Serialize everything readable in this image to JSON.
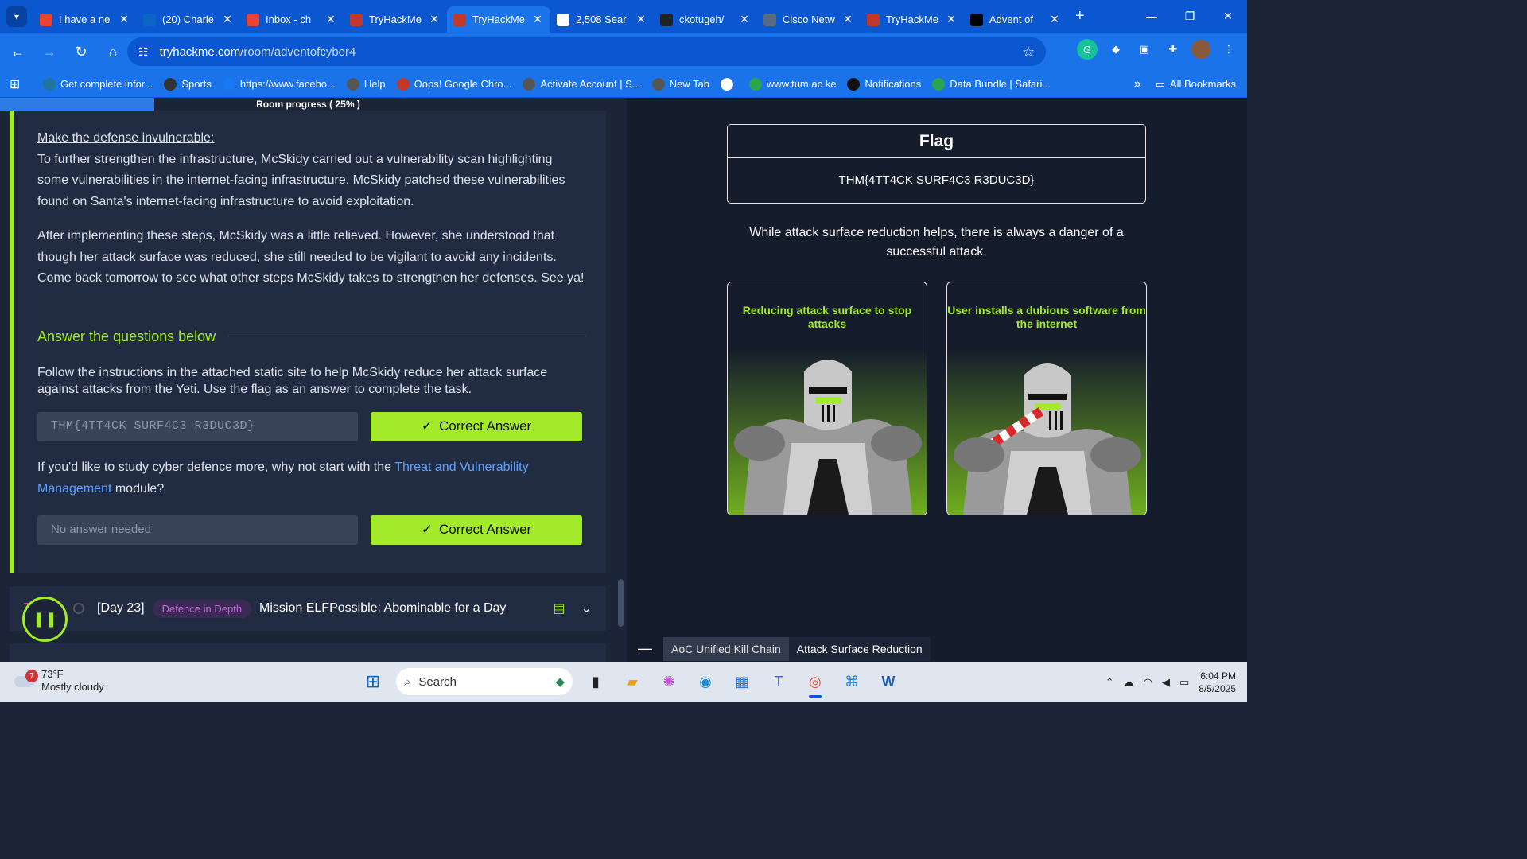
{
  "browser": {
    "tabs": [
      {
        "title": "I have a ne",
        "favicon": "gmail",
        "color": "#ea4335"
      },
      {
        "title": "(20) Charle",
        "favicon": "linkedin",
        "color": "#0a66c2"
      },
      {
        "title": "Inbox - ch",
        "favicon": "gmail",
        "color": "#ea4335"
      },
      {
        "title": "TryHackMe",
        "favicon": "tryhackme",
        "color": "#c0392b"
      },
      {
        "title": "TryHackMe",
        "favicon": "tryhackme",
        "color": "#c0392b",
        "active": true
      },
      {
        "title": "2,508 Sear",
        "favicon": "github",
        "color": "#ffffff"
      },
      {
        "title": "ckotugeh/",
        "favicon": "github",
        "color": "#222222"
      },
      {
        "title": "Cisco Netw",
        "favicon": "cisco",
        "color": "#5b6b7f"
      },
      {
        "title": "TryHackMe",
        "favicon": "tryhackme",
        "color": "#c0392b"
      },
      {
        "title": "Advent of",
        "favicon": "medium",
        "color": "#000000"
      }
    ],
    "url_domain": "tryhackme.com",
    "url_path": "/room/adventofcyber4",
    "bookmarks": [
      {
        "label": "Get complete infor...",
        "icon": "wordpress"
      },
      {
        "label": "Sports",
        "icon": "sp"
      },
      {
        "label": "https://www.facebo...",
        "icon": "facebook"
      },
      {
        "label": "Help",
        "icon": "globe"
      },
      {
        "label": "Oops! Google Chro...",
        "icon": "tryhackme"
      },
      {
        "label": "Activate Account | S...",
        "icon": "globe"
      },
      {
        "label": "New Tab",
        "icon": "globe"
      },
      {
        "label": "",
        "icon": "google"
      },
      {
        "label": "www.tum.ac.ke",
        "icon": "s"
      },
      {
        "label": "Notifications",
        "icon": "upwork"
      },
      {
        "label": "Data Bundle | Safari...",
        "icon": "s"
      }
    ],
    "all_bookmarks": "All Bookmarks"
  },
  "room": {
    "progress_label": "Room progress ( 25% )",
    "progress_value": 0.25,
    "heading": "Make the defense invulnerable:",
    "para1": "To further strengthen the infrastructure, McSkidy carried out a vulnerability scan highlighting some vulnerabilities in the internet-facing infrastructure. McSkidy patched these vulnerabilities found on Santa's internet-facing infrastructure to avoid exploitation.",
    "para2": "After implementing these steps, McSkidy was a little relieved. However, she understood that though her attack surface was reduced, she still needed to be vigilant to avoid any incidents. Come back tomorrow to see what other steps McSkidy takes to strengthen her defenses. See ya!",
    "answer_heading": "Answer the questions below",
    "q1": "Follow the instructions in the attached static site to help McSkidy reduce her attack surface against attacks from the Yeti. Use the flag as an answer to complete the task.",
    "q1_answer": "THM{4TT4CK SURF4C3 R3DUC3D}",
    "correct_label": "Correct Answer",
    "q2_prefix": "If you'd like to study cyber defence more, why not start with the ",
    "q2_link": "Threat and Vulnerability Management",
    "q2_suffix": " module?",
    "q2_answer": "No answer needed",
    "next_day": "[Day 23]",
    "next_tag": "Defence in Depth",
    "next_title": "Mission ELFPossible: Abominable for a Day",
    "next_task_prefix": "T"
  },
  "site": {
    "flag_title": "Flag",
    "flag_value": "THM{4TT4CK SURF4C3 R3DUC3D}",
    "note": "While attack surface reduction helps, there is always a danger of a successful attack.",
    "card1_caption": "Reducing attack surface to stop attacks",
    "card2_caption": "User installs a dubious software from the internet",
    "tab_kill_chain": "AoC Unified Kill Chain",
    "tab_asr": "Attack Surface Reduction"
  },
  "taskbar": {
    "temp": "73°F",
    "weather": "Mostly cloudy",
    "weather_badge": "7",
    "search": "Search",
    "time": "6:04 PM",
    "date": "8/5/2025"
  },
  "colors": {
    "accent": "#a3ea2a",
    "chrome_blue": "#1a73e8",
    "link": "#5fa0ff"
  }
}
